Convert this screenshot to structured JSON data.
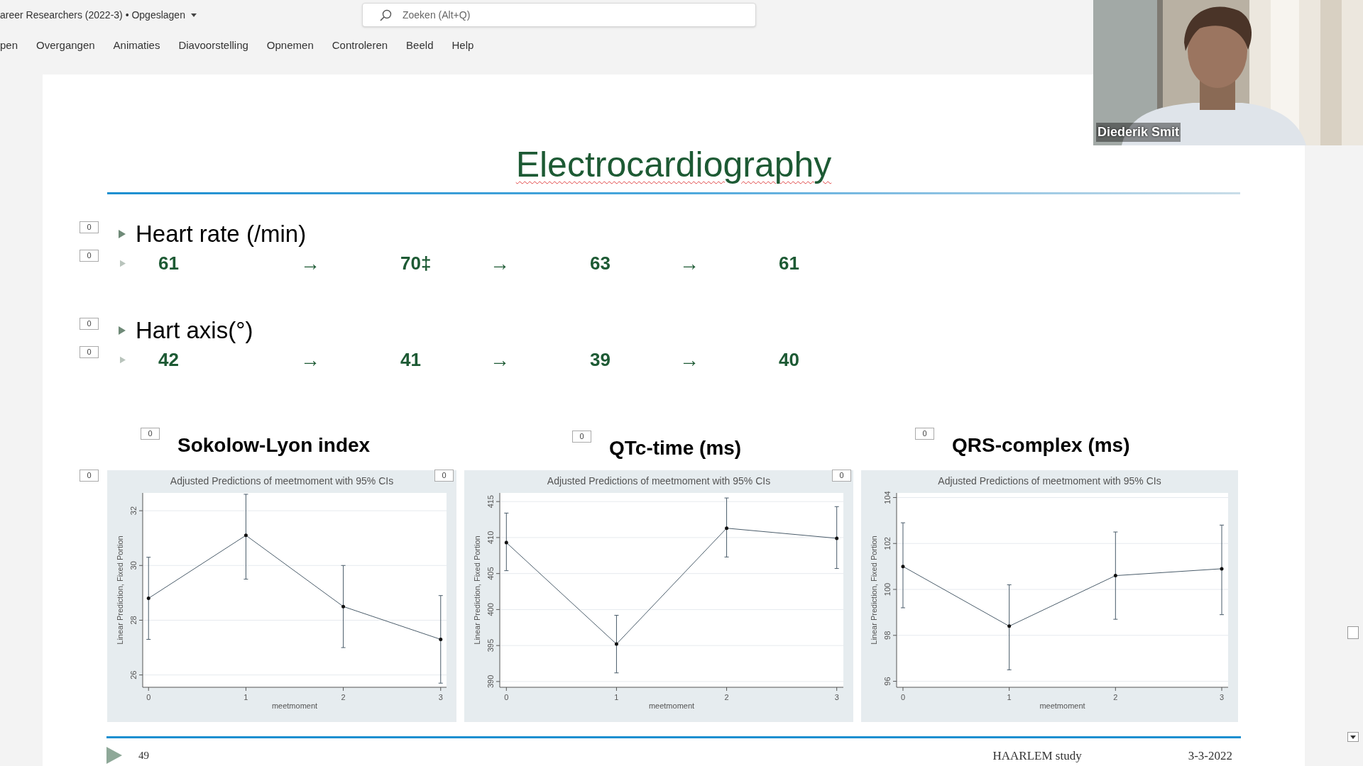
{
  "title_bar": {
    "title": "areer Researchers (2022-3) • Opgeslagen",
    "search": {
      "placeholder": "Zoeken (Alt+Q)"
    }
  },
  "ribbon_tabs": [
    "pen",
    "Overgangen",
    "Animaties",
    "Diavoorstelling",
    "Opnemen",
    "Controleren",
    "Beeld",
    "Help"
  ],
  "video": {
    "kind": "picture",
    "name": "Diederik Smit"
  },
  "slide": {
    "title": "Electrocardiography",
    "sections": [
      {
        "heading": "Heart rate (/min)",
        "heading_marker": "0",
        "values_marker": "0",
        "items": [
          {
            "kind": "value",
            "text": "61"
          },
          {
            "kind": "arrow",
            "text": "→"
          },
          {
            "kind": "value",
            "text": "70‡"
          },
          {
            "kind": "arrow",
            "text": "→"
          },
          {
            "kind": "value",
            "text": "63"
          },
          {
            "kind": "arrow",
            "text": "→"
          },
          {
            "kind": "value",
            "text": "61"
          }
        ]
      },
      {
        "heading": "Hart axis(°)",
        "heading_marker": "0",
        "values_marker": "0",
        "items": [
          {
            "kind": "value",
            "text": "42"
          },
          {
            "kind": "arrow",
            "text": "→"
          },
          {
            "kind": "value",
            "text": "41"
          },
          {
            "kind": "arrow",
            "text": "→"
          },
          {
            "kind": "value",
            "text": "39"
          },
          {
            "kind": "arrow",
            "text": "→"
          },
          {
            "kind": "value",
            "text": "40"
          }
        ]
      }
    ],
    "image_markers": [
      "0",
      "0",
      "0"
    ],
    "charts": [
      {
        "heading": "Sokolow-Lyon index",
        "heading_marker": "0",
        "chart_data": {
          "type": "line",
          "title": "Adjusted Predictions of meetmoment with 95% CIs",
          "xlabel": "meetmoment",
          "ylabel": "Linear Prediction, Fixed Portion",
          "x": [
            0,
            1,
            2,
            3
          ],
          "xlim": [
            -0.06,
            3.06
          ],
          "ylim": [
            25.55,
            32.65
          ],
          "xticks": [
            0,
            1,
            2,
            3
          ],
          "yticks": [
            26,
            28,
            30,
            32
          ],
          "grid": true,
          "series": [
            {
              "color": "#4a5c6a",
              "values": [
                28.8,
                31.1,
                28.5,
                27.3
              ],
              "errors": [
                [
                  27.3,
                  30.3
                ],
                [
                  29.5,
                  32.6
                ],
                [
                  27.0,
                  30.0
                ],
                [
                  25.7,
                  28.9
                ]
              ]
            }
          ]
        }
      },
      {
        "heading": "QTc-time (ms)",
        "heading_marker": "0",
        "chart_data": {
          "type": "line",
          "title": "Adjusted Predictions of meetmoment with 95% CIs",
          "xlabel": "meetmoment",
          "ylabel": "Linear Prediction, Fixed Portion",
          "x": [
            0,
            1,
            2,
            3
          ],
          "xlim": [
            -0.06,
            3.06
          ],
          "ylim": [
            389.2,
            416.2
          ],
          "xticks": [
            0,
            1,
            2,
            3
          ],
          "yticks": [
            390,
            395,
            400,
            405,
            410,
            415
          ],
          "grid": true,
          "series": [
            {
              "color": "#4a5c6a",
              "values": [
                409.3,
                395.2,
                411.3,
                409.9
              ],
              "errors": [
                [
                  405.4,
                  413.4
                ],
                [
                  391.2,
                  399.2
                ],
                [
                  407.3,
                  415.5
                ],
                [
                  405.7,
                  414.3
                ]
              ]
            }
          ]
        }
      },
      {
        "heading": "QRS-complex (ms)",
        "heading_marker": "0",
        "chart_data": {
          "type": "line",
          "title": "Adjusted Predictions of meetmoment with 95% CIs",
          "xlabel": "meetmoment",
          "ylabel": "Linear Prediction, Fixed Portion",
          "x": [
            0,
            1,
            2,
            3
          ],
          "xlim": [
            -0.06,
            3.06
          ],
          "ylim": [
            95.74,
            104.2
          ],
          "xticks": [
            0,
            1,
            2,
            3
          ],
          "yticks": [
            96,
            98,
            100,
            102,
            104
          ],
          "grid": true,
          "series": [
            {
              "color": "#4a5c6a",
              "values": [
                101.0,
                98.4,
                100.6,
                100.9
              ],
              "errors": [
                [
                  99.2,
                  102.9
                ],
                [
                  96.5,
                  100.2
                ],
                [
                  98.7,
                  102.5
                ],
                [
                  98.9,
                  102.8
                ]
              ]
            }
          ]
        }
      }
    ]
  },
  "footer": {
    "slide_number": "49",
    "text": "HAARLEM study",
    "date": "3-3-2022"
  }
}
